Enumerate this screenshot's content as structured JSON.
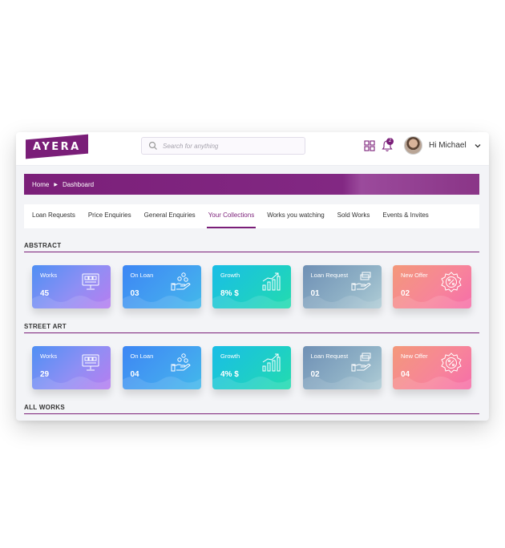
{
  "app": {
    "logo": "AYERA"
  },
  "header": {
    "search_placeholder": "Search for anything",
    "notification_count": "2",
    "greeting": "Hi Michael"
  },
  "breadcrumb": {
    "home": "Home",
    "current": "Dashboard"
  },
  "tabs": [
    {
      "label": "Loan Requests",
      "active": false
    },
    {
      "label": "Price Enquiries",
      "active": false
    },
    {
      "label": "General Enquiries",
      "active": false
    },
    {
      "label": "Your Collections",
      "active": true
    },
    {
      "label": "Works you watching",
      "active": false
    },
    {
      "label": "Sold Works",
      "active": false
    },
    {
      "label": "Events & Invites",
      "active": false
    }
  ],
  "sections": [
    {
      "title": "ABSTRACT",
      "cards": [
        {
          "label": "Works",
          "value": "45",
          "icon": "monitor-icon"
        },
        {
          "label": "On Loan",
          "value": "03",
          "icon": "hand-coins-icon"
        },
        {
          "label": "Growth",
          "value": "8% $",
          "icon": "growth-chart-icon"
        },
        {
          "label": "Loan Request",
          "value": "01",
          "icon": "hand-money-icon"
        },
        {
          "label": "New Offer",
          "value": "02",
          "icon": "percent-badge-icon"
        }
      ]
    },
    {
      "title": "STREET ART",
      "cards": [
        {
          "label": "Works",
          "value": "29",
          "icon": "monitor-icon"
        },
        {
          "label": "On Loan",
          "value": "04",
          "icon": "hand-coins-icon"
        },
        {
          "label": "Growth",
          "value": "4% $",
          "icon": "growth-chart-icon"
        },
        {
          "label": "Loan Request",
          "value": "02",
          "icon": "hand-money-icon"
        },
        {
          "label": "New Offer",
          "value": "04",
          "icon": "percent-badge-icon"
        }
      ]
    },
    {
      "title": "ALL WORKS",
      "cards": []
    }
  ],
  "colors": {
    "brand": "#7a1e78"
  }
}
